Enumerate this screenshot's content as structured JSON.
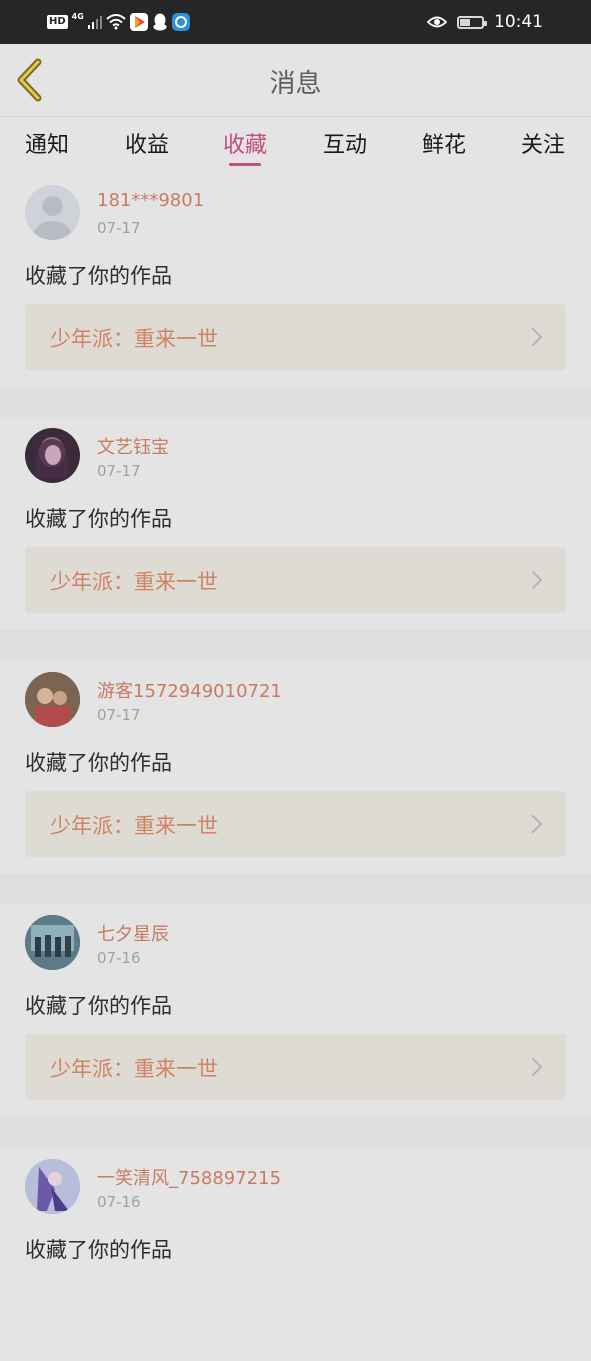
{
  "status_bar": {
    "hd": "HD",
    "network": "4G",
    "time": "10:41",
    "battery_level": 0.45,
    "app_icons": [
      "video-app-icon",
      "qq-icon",
      "browser-icon"
    ]
  },
  "header": {
    "title": "消息",
    "back_icon": "chevron-left-icon"
  },
  "tabs": [
    {
      "label": "通知",
      "active": false
    },
    {
      "label": "收益",
      "active": false
    },
    {
      "label": "收藏",
      "active": true
    },
    {
      "label": "互动",
      "active": false
    },
    {
      "label": "鲜花",
      "active": false
    },
    {
      "label": "关注",
      "active": false
    }
  ],
  "colors": {
    "accent": "#c24d80",
    "username": "#c87a62",
    "work_title": "#cf8360"
  },
  "messages": [
    {
      "user": "181***9801",
      "date": "07-17",
      "action": "收藏了你的作品",
      "work_title": "少年派：重来一世"
    },
    {
      "user": "文艺钰宝",
      "date": "07-17",
      "action": "收藏了你的作品",
      "work_title": "少年派：重来一世"
    },
    {
      "user": "游客1572949010721",
      "date": "07-17",
      "action": "收藏了你的作品",
      "work_title": "少年派：重来一世"
    },
    {
      "user": "七夕星辰",
      "date": "07-16",
      "action": "收藏了你的作品",
      "work_title": "少年派：重来一世"
    },
    {
      "user": "一笑清风_758897215",
      "date": "07-16",
      "action": "收藏了你的作品",
      "work_title": ""
    }
  ]
}
